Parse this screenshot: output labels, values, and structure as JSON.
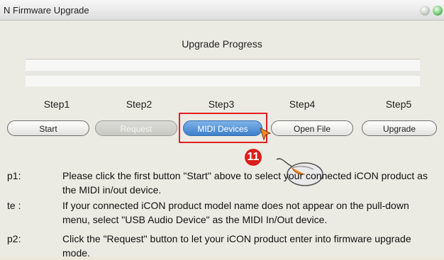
{
  "window": {
    "title": "N Firmware Upgrade"
  },
  "progress": {
    "title": "Upgrade Progress",
    "fill_fraction": 0
  },
  "steps": [
    {
      "label": "Step1",
      "button": "Start",
      "state": "normal"
    },
    {
      "label": "Step2",
      "button": "Request",
      "state": "disabled"
    },
    {
      "label": "Step3",
      "button": "MIDI Devices",
      "state": "active"
    },
    {
      "label": "Step4",
      "button": "Open File",
      "state": "normal"
    },
    {
      "label": "Step5",
      "button": "Upgrade",
      "state": "normal"
    }
  ],
  "annotation": {
    "badge": "11",
    "highlight_color": "#e32022",
    "badge_color": "#d8201c"
  },
  "instructions": [
    {
      "label": "p1:",
      "text": "Please click the first button \"Start\" above to select your connected iCON product as the MIDI in/out device."
    },
    {
      "label": "te :",
      "text": "If your connected iCON product model name does not appear on the pull-down menu, select \"USB Audio Device\" as the MIDI In/Out device."
    },
    {
      "label": "p2:",
      "text": "Click the \"Request\" button to let your iCON product enter into firmware upgrade mode."
    }
  ]
}
